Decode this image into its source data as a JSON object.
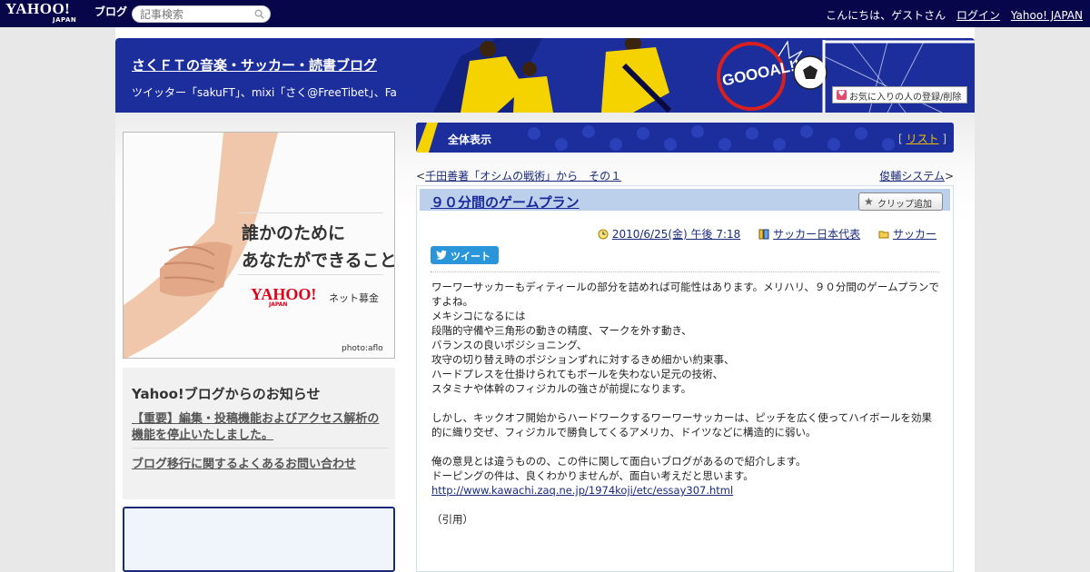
{
  "topbar": {
    "logo_text": "YAHOO!",
    "logo_sub": "JAPAN",
    "logo_blog": "ブログ",
    "search_placeholder": "記事検索",
    "greeting": "こんにちは、ゲストさん",
    "login": "ログイン",
    "yahoo_japan": "Yahoo! JAPAN"
  },
  "header": {
    "title": "さくＦＴの音楽・サッカー・読書ブログ",
    "description": "ツイッター「sakuFT」、mixi「さく@FreeTibet」、Facebook「sakuFT」",
    "banner_text": "GOOOAL!!",
    "favorite_button": "お気に入りの人の登録/削除"
  },
  "ad": {
    "copy_line1": "誰かのために",
    "copy_line2": "あなたができること",
    "brand": "YAHOO!",
    "brand_sub": "JAPAN",
    "service": "ネット募金",
    "photo_credit": "photo:aflo"
  },
  "notice": {
    "title": "Yahoo!ブログからのお知らせ",
    "items": [
      "【重要】編集・投稿機能およびアクセス解析の機能を停止いたしました。",
      "ブログ移行に関するよくあるお問い合わせ"
    ]
  },
  "section": {
    "title": "全体表示",
    "list_open": "[",
    "list_label": "リスト",
    "list_close": "]"
  },
  "nav": {
    "prev_arrow": "<",
    "prev": "千田善著「オシムの戦術」から　その１",
    "next": "俊輔システム",
    "next_arrow": ">"
  },
  "article": {
    "title": "９０分間のゲームプラン",
    "clip_button": "クリップ追加",
    "date": "2010/6/25(金) 午後 7:18",
    "category1": "サッカー日本代表",
    "category2": "サッカー",
    "tweet": "ツイート",
    "paragraph1": "ワーワーサッカーもディティールの部分を詰めれば可能性はあります。メリハリ、９０分間のゲームプランですよね。\nメキシコになるには\n段階的守備や三角形の動きの精度、マークを外す動き、\nバランスの良いポジショニング、\n攻守の切り替え時のポジションずれに対するきめ細かい約束事、\nハードプレスを仕掛けられてもボールを失わない足元の技術、\nスタミナや体幹のフィジカルの強さが前提になります。",
    "paragraph2": "しかし、キックオフ開始からハードワークするワーワーサッカーは、ピッチを広く使ってハイボールを効果的に織り交ぜ、フィジカルで勝負してくるアメリカ、ドイツなどに構造的に弱い。",
    "paragraph3": "俺の意見とは違うものの、この件に関して面白いブログがあるので紹介します。\nドーピングの件は、良くわかりませんが、面白い考えだと思います。",
    "link": "http://www.kawachi.zaq.ne.jp/1974koji/etc/essay307.html",
    "quote_label": "（引用）"
  },
  "colors": {
    "topbar": "#08064b",
    "header": "#1b2e9c",
    "title_bar": "#bcd0ec",
    "link": "#1a2a7a",
    "accent_yellow": "#f0c000"
  }
}
